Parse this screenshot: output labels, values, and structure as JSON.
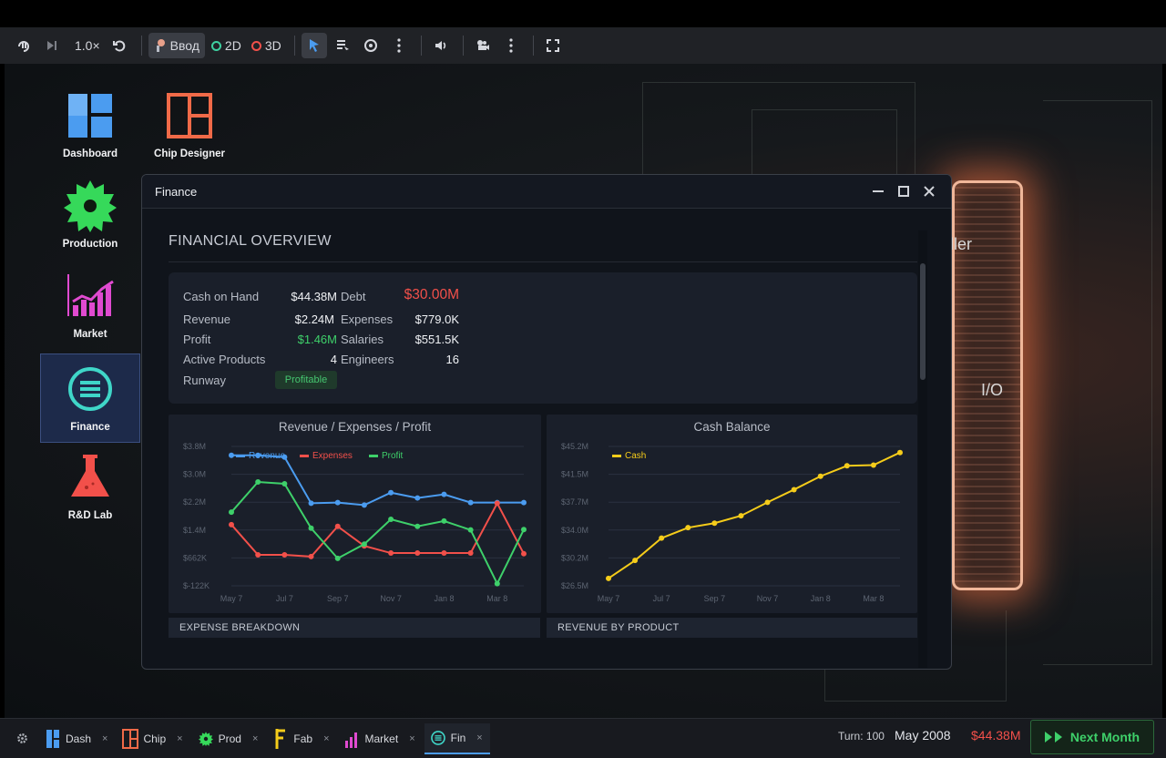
{
  "toolbar": {
    "speed": "1.0×",
    "input_label": "Ввод",
    "mode_2d": "2D",
    "mode_3d": "3D"
  },
  "desktop": {
    "icons": [
      {
        "label": "Dashboard",
        "icon": "dashboard-icon"
      },
      {
        "label": "Chip Designer",
        "icon": "chip-designer-icon"
      },
      {
        "label": "Production",
        "icon": "gear-icon"
      },
      {
        "label": "Market",
        "icon": "bar-chart-icon"
      },
      {
        "label": "Finance",
        "icon": "finance-icon"
      },
      {
        "label": "R&D Lab",
        "icon": "flask-icon"
      }
    ],
    "chip_labels": {
      "ller": "ller",
      "io": "I/O"
    }
  },
  "window": {
    "title": "Finance",
    "overview_title": "FINANCIAL OVERVIEW",
    "stats": {
      "cash_label": "Cash on Hand",
      "cash_value": "$44.38M",
      "debt_label": "Debt",
      "debt_value": "$30.00M",
      "revenue_label": "Revenue",
      "revenue_value": "$2.24M",
      "expenses_label": "Expenses",
      "expenses_value": "$779.0K",
      "profit_label": "Profit",
      "profit_value": "$1.46M",
      "salaries_label": "Salaries",
      "salaries_value": "$551.5K",
      "products_label": "Active Products",
      "products_value": "4",
      "engineers_label": "Engineers",
      "engineers_value": "16",
      "runway_label": "Runway",
      "runway_value": "Profitable"
    },
    "expense_breakdown": "EXPENSE BREAKDOWN",
    "revenue_by_product": "REVENUE BY PRODUCT"
  },
  "chart_data": [
    {
      "type": "line",
      "title": "Revenue / Expenses / Profit",
      "x": [
        "May 7",
        "Jun 7",
        "Jul 7",
        "Aug 7",
        "Sep 7",
        "Oct 7",
        "Nov 7",
        "Dec 7",
        "Jan 8",
        "Feb 8",
        "Mar 8",
        "Apr 8"
      ],
      "xticks": [
        "May 7",
        "Jul 7",
        "Sep 7",
        "Nov 7",
        "Jan 8",
        "Mar 8"
      ],
      "yticks": [
        "$3.8M",
        "$3.0M",
        "$2.2M",
        "$1.4M",
        "$662K",
        "$-122K"
      ],
      "ylim": [
        -0.122,
        3.8
      ],
      "legend": "top",
      "series": [
        {
          "name": "Revenue",
          "color": "#4b9cf0",
          "values": [
            3.55,
            3.55,
            3.5,
            2.2,
            2.22,
            2.15,
            2.5,
            2.35,
            2.45,
            2.22,
            2.22,
            2.22
          ]
        },
        {
          "name": "Expenses",
          "color": "#f2504a",
          "values": [
            1.6,
            0.75,
            0.75,
            0.7,
            1.55,
            1.0,
            0.8,
            0.8,
            0.8,
            0.8,
            2.2,
            0.78
          ]
        },
        {
          "name": "Profit",
          "color": "#3ed06a",
          "values": [
            1.95,
            2.8,
            2.75,
            1.5,
            0.65,
            1.05,
            1.75,
            1.55,
            1.7,
            1.45,
            -0.06,
            1.46
          ]
        }
      ]
    },
    {
      "type": "line",
      "title": "Cash Balance",
      "x": [
        "May 7",
        "Jun 7",
        "Jul 7",
        "Aug 7",
        "Sep 7",
        "Oct 7",
        "Nov 7",
        "Dec 7",
        "Jan 8",
        "Feb 8",
        "Mar 8",
        "Apr 8"
      ],
      "xticks": [
        "May 7",
        "Jul 7",
        "Sep 7",
        "Nov 7",
        "Jan 8",
        "Mar 8"
      ],
      "yticks": [
        "$45.2M",
        "$41.5M",
        "$37.7M",
        "$34.0M",
        "$30.2M",
        "$26.5M"
      ],
      "ylim": [
        26.5,
        45.2
      ],
      "legend": "top-left",
      "series": [
        {
          "name": "Cash",
          "color": "#f5cc1a",
          "values": [
            27.5,
            29.9,
            32.9,
            34.3,
            34.9,
            35.9,
            37.7,
            39.4,
            41.2,
            42.6,
            42.7,
            44.38
          ]
        }
      ]
    }
  ],
  "taskbar": {
    "tabs": [
      {
        "label": "Dash",
        "icon": "dashboard-icon"
      },
      {
        "label": "Chip",
        "icon": "chip-designer-icon"
      },
      {
        "label": "Prod",
        "icon": "gear-icon"
      },
      {
        "label": "Fab",
        "icon": "fab-icon"
      },
      {
        "label": "Market",
        "icon": "bar-chart-icon"
      },
      {
        "label": "Fin",
        "icon": "finance-icon"
      }
    ],
    "close_glyph": "×",
    "turn": "Turn: 100",
    "date": "May 2008",
    "cash": "$44.38M",
    "next_label": "Next Month"
  }
}
